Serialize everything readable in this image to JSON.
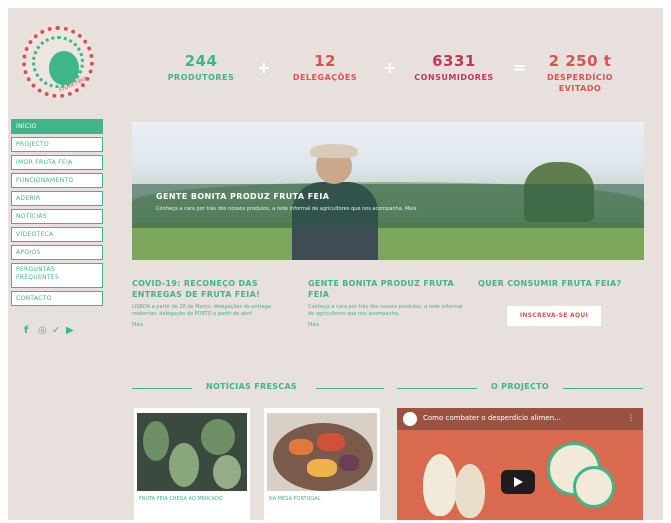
{
  "brand": {
    "logo_text": "Fruta Feia"
  },
  "stats": [
    {
      "value": "244",
      "label": "PRODUTORES",
      "color": "#3fb58c"
    },
    {
      "value": "12",
      "label": "DELEGAÇÕES",
      "color": "#d9534f"
    },
    {
      "value": "6331",
      "label": "CONSUMIDORES",
      "color": "#c2375b"
    },
    {
      "value": "2 250 t",
      "label": "DESPERDÍCIO EVITADO",
      "color": "#d9534f"
    }
  ],
  "operators": [
    "+",
    "+",
    "="
  ],
  "nav": [
    {
      "label": "INÍCIO"
    },
    {
      "label": "PROJECTO"
    },
    {
      "label": "IMOR FRUTA FEIA"
    },
    {
      "label": "FUNCIONAMENTO"
    },
    {
      "label": "ADERIR"
    },
    {
      "label": "NOTÍCIAS"
    },
    {
      "label": "VÍDEOTECA"
    },
    {
      "label": "APOIOS"
    },
    {
      "label": "PERGUNTAS FREQUENTES"
    },
    {
      "label": "CONTACTO"
    }
  ],
  "social_icons": [
    "facebook-icon",
    "instagram-icon",
    "twitter-icon",
    "youtube-icon"
  ],
  "hero": {
    "title": "GENTE BONITA PRODUZ FRUTA FEIA",
    "subtitle": "Conheça a cara por trás dos nossos produtos, a rede informal de agricultores que nos acompanha. Mais"
  },
  "features": [
    {
      "title": "COVID-19: RECONEÇO DAS ENTREGAS DE FRUTA FEIA!",
      "text": "LISBOA a partir de 28 de Março: delegações de entrega reabertas; delegação do PORTO a partir de abril",
      "more": "Mais"
    },
    {
      "title": "GENTE BONITA PRODUZ FRUTA FEIA",
      "text": "Conheça a cara por trás dos nossos produtos, a rede informal de agricultores que nos acompanha.",
      "more": "Mais"
    },
    {
      "title": "QUER CONSUMIR FRUTA FEIA?",
      "cta": "INSCREVA-SE AQUI"
    }
  ],
  "sections": {
    "news": "NOTÍCIAS FRESCAS",
    "project": "O PROJECTO"
  },
  "news": [
    {
      "caption": "FRUTA FEIA CHEGA AO MERCADO"
    },
    {
      "caption": "NA MESA PORTUGAL"
    }
  ],
  "video": {
    "title": "Como combater o desperdício alimen...",
    "menu": "⋮"
  }
}
